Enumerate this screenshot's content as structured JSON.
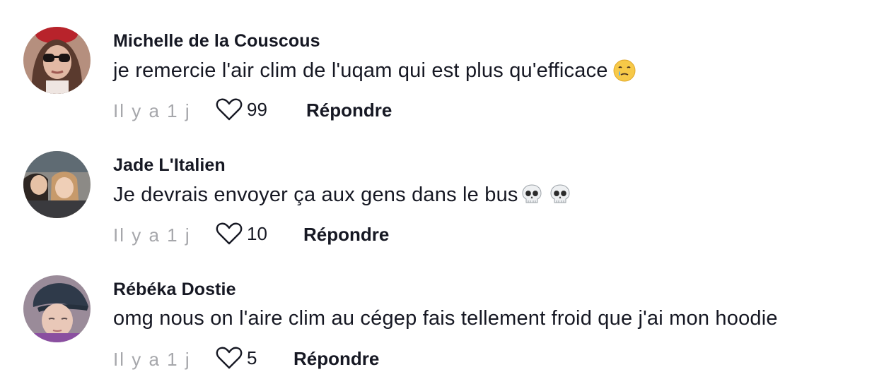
{
  "comments": [
    {
      "author": "Michelle de la Couscous",
      "text": "je remercie l'air clim de l'uqam qui est plus qu'efficace",
      "emoji": [
        "face-holding-back-tears"
      ],
      "time": "Il y a 1 j",
      "likes": "99",
      "reply_label": "Répondre"
    },
    {
      "author": "Jade L'Italien",
      "text": "Je devrais envoyer ça aux gens dans le bus",
      "emoji": [
        "skull",
        "skull"
      ],
      "time": "Il y a 1 j",
      "likes": "10",
      "reply_label": "Répondre"
    },
    {
      "author": "Rébéka Dostie",
      "text": "omg nous on l'aire clim au cégep fais tellement froid que j'ai mon hoodie",
      "emoji": [],
      "time": "Il y a 1 j",
      "likes": "5",
      "reply_label": "Répondre"
    }
  ],
  "icons": {
    "like": "heart-outline-icon"
  },
  "colors": {
    "text": "#161823",
    "muted": "#a6a7ab",
    "background": "#ffffff"
  }
}
